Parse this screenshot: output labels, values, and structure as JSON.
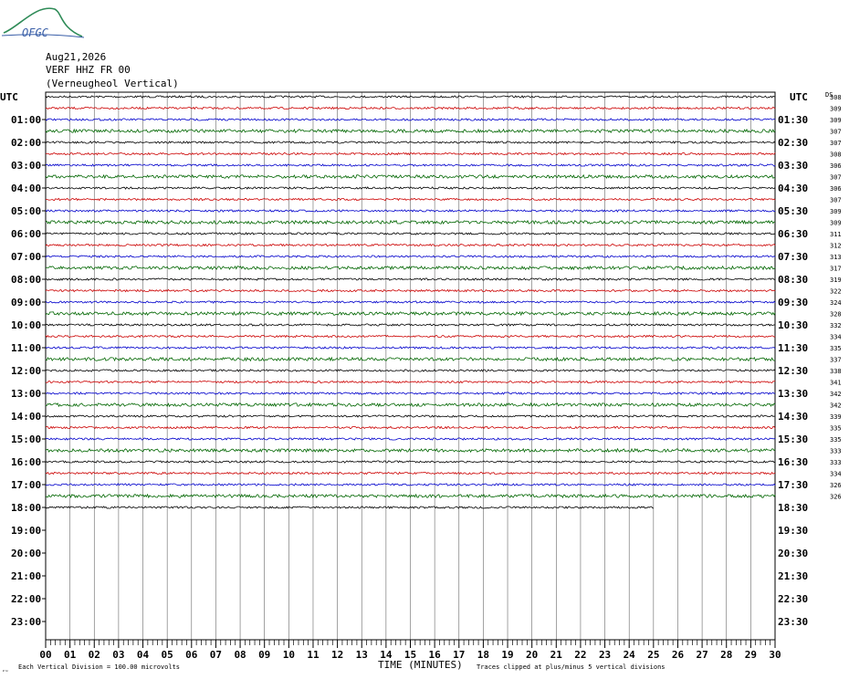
{
  "logo": {
    "text": "OFGC",
    "icon": "ofgc-logo"
  },
  "header": {
    "date": "Aug21,2026",
    "station": "VERF HHZ FR 00",
    "site": "(Verneugheol Vertical)"
  },
  "axes": {
    "left_label": "UTC",
    "right_label": "UTC",
    "ds_label": "DS",
    "xlabel": "TIME (MINUTES)",
    "footer_left": "Each Vertical Division =  100.00 microvolts",
    "footer_right": "Traces clipped at plus/minus 5 vertical divisions"
  },
  "colors": {
    "black": "#000000",
    "red": "#cc0000",
    "blue": "#0000cc",
    "green": "#006600",
    "grid": "#000000"
  },
  "chart_data": {
    "type": "line",
    "title": "",
    "x_range": [
      0,
      30
    ],
    "x_ticks": [
      "00",
      "01",
      "02",
      "03",
      "04",
      "05",
      "06",
      "07",
      "08",
      "09",
      "10",
      "11",
      "12",
      "13",
      "14",
      "15",
      "16",
      "17",
      "18",
      "19",
      "20",
      "21",
      "22",
      "23",
      "24",
      "25",
      "26",
      "27",
      "28",
      "29",
      "30"
    ],
    "left_hours": [
      "01:00",
      "02:00",
      "03:00",
      "04:00",
      "05:00",
      "06:00",
      "07:00",
      "08:00",
      "09:00",
      "10:00",
      "11:00",
      "12:00",
      "13:00",
      "14:00",
      "15:00",
      "16:00",
      "17:00",
      "18:00",
      "19:00",
      "20:00",
      "21:00",
      "22:00",
      "23:00"
    ],
    "right_hours": [
      "01:30",
      "02:30",
      "03:30",
      "04:30",
      "05:30",
      "06:30",
      "07:30",
      "08:30",
      "09:30",
      "10:30",
      "11:30",
      "12:30",
      "13:30",
      "14:30",
      "15:30",
      "16:30",
      "17:30",
      "18:30",
      "19:30",
      "20:30",
      "21:30",
      "22:30",
      "23:30"
    ],
    "trace_color_cycle": [
      "black",
      "red",
      "blue",
      "green"
    ],
    "traces_with_data": 37,
    "last_trace_end_minute": 25,
    "ds_values": [
      "308",
      "309",
      "309",
      "307",
      "307",
      "308",
      "306",
      "307",
      "306",
      "307",
      "309",
      "309",
      "311",
      "312",
      "313",
      "317",
      "319",
      "322",
      "324",
      "328",
      "332",
      "334",
      "335",
      "337",
      "338",
      "341",
      "342",
      "342",
      "339",
      "335",
      "335",
      "333",
      "333",
      "334",
      "326",
      "326"
    ],
    "units": "100.00 microvolts per vertical division",
    "clip": "plus/minus 5 vertical divisions"
  }
}
